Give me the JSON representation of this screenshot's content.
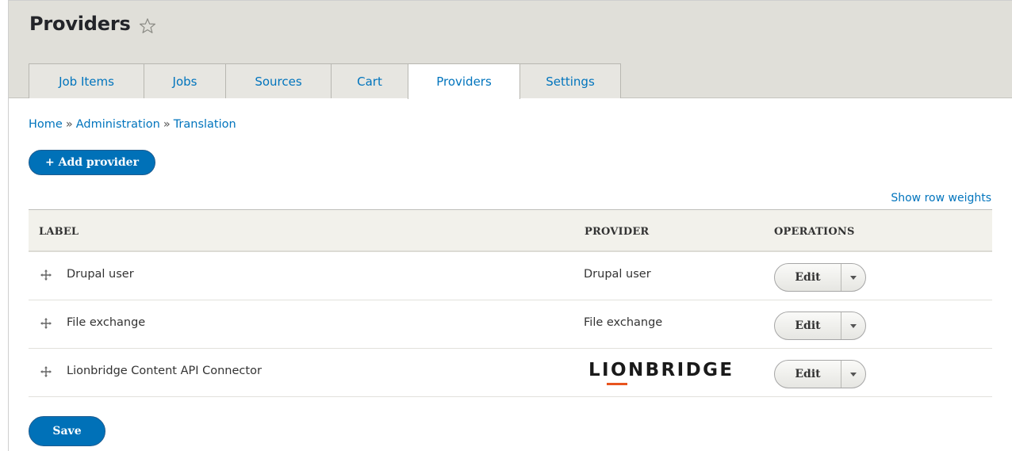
{
  "header": {
    "title": "Providers",
    "tabs": [
      {
        "label": "Job Items",
        "width": 146
      },
      {
        "label": "Jobs",
        "width": 104
      },
      {
        "label": "Sources",
        "width": 134
      },
      {
        "label": "Cart",
        "width": 98
      },
      {
        "label": "Providers",
        "width": 142,
        "active": true
      },
      {
        "label": "Settings",
        "width": 128
      }
    ]
  },
  "breadcrumb": {
    "items": [
      "Home",
      "Administration",
      "Translation"
    ],
    "separator": "»"
  },
  "actions": {
    "add_provider": "+ Add provider",
    "show_row_weights": "Show row weights",
    "save": "Save"
  },
  "table": {
    "headers": {
      "label": "LABEL",
      "provider": "PROVIDER",
      "operations": "OPERATIONS"
    },
    "rows": [
      {
        "label": "Drupal user",
        "provider": "Drupal user",
        "operation": "Edit"
      },
      {
        "label": "File exchange",
        "provider": "File exchange",
        "operation": "Edit"
      },
      {
        "label": "Lionbridge Content API Connector",
        "provider": "",
        "provider_logo": "LIONBRIDGE",
        "operation": "Edit"
      }
    ]
  },
  "colors": {
    "link": "#0074bd",
    "primary_button": "#0071b8",
    "header_bg": "#e0dfd9",
    "logo_accent": "#e8541e"
  },
  "icons": {
    "favorite": "star-outline-icon",
    "drag": "drag-handle-icon",
    "dropdown": "caret-down-icon"
  }
}
